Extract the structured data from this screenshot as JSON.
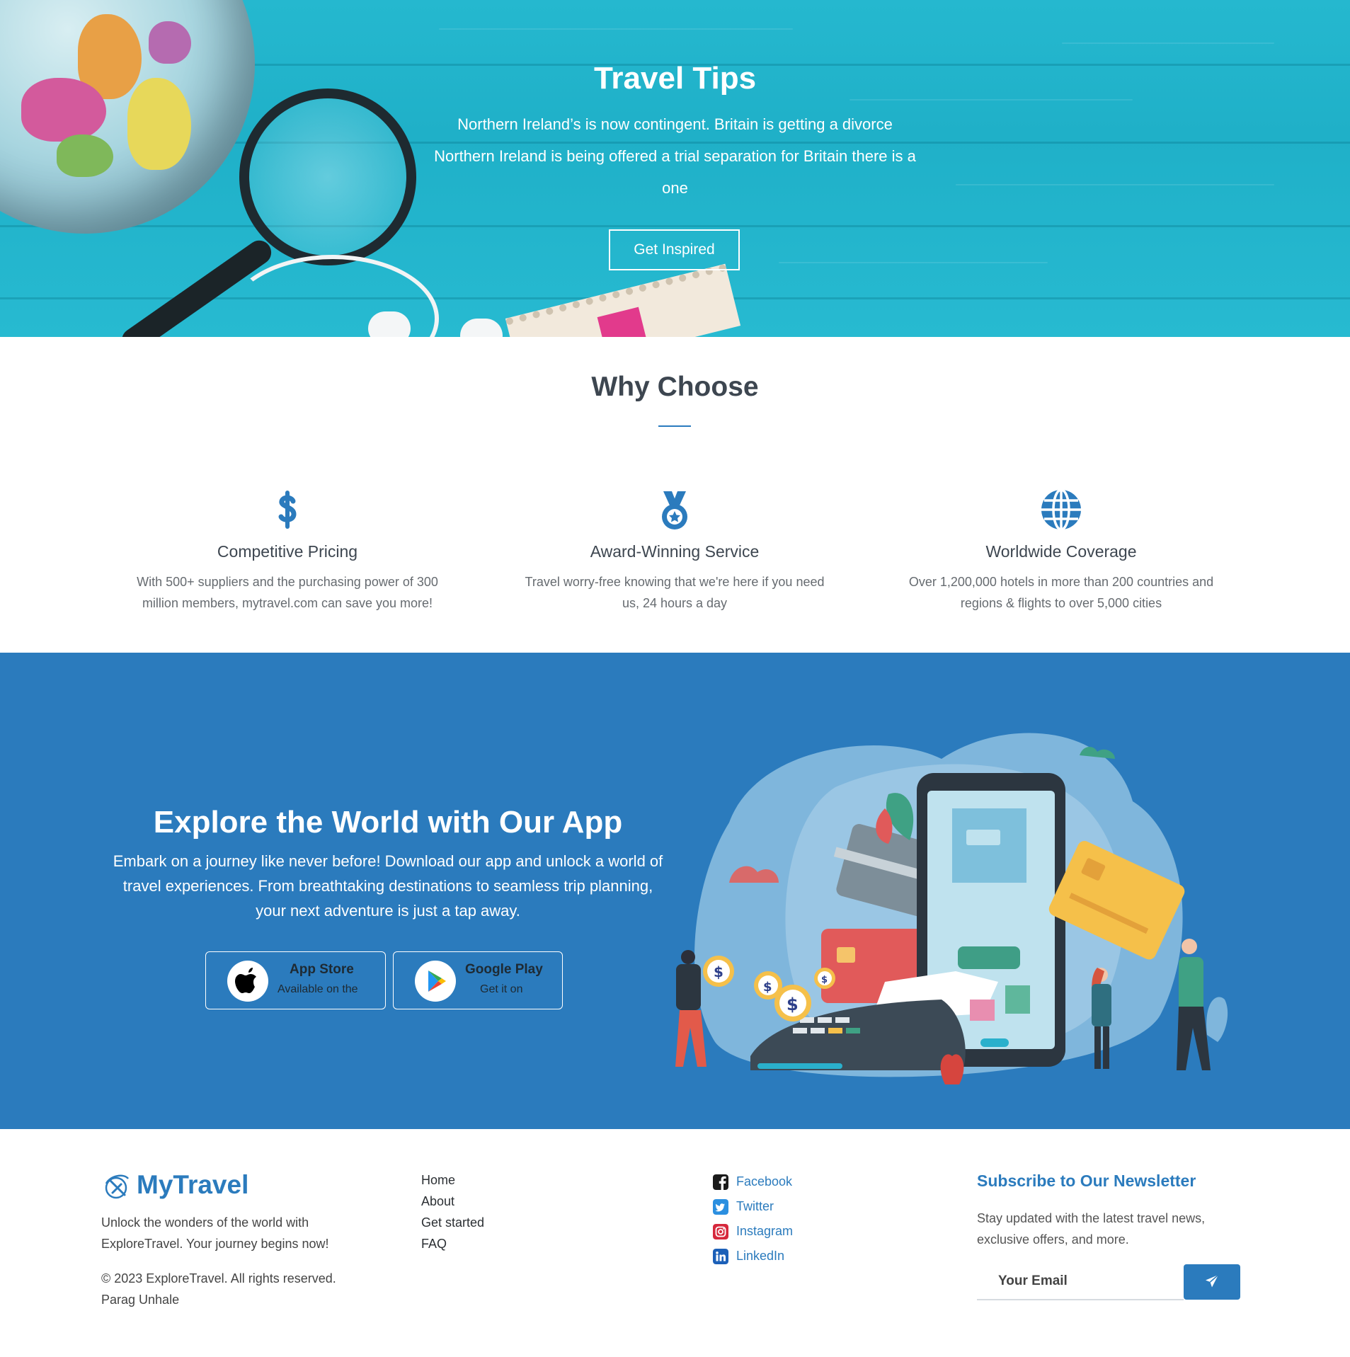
{
  "hero": {
    "title": "Travel Tips",
    "subtitle_lines": [
      "Northern Ireland’s is now contingent. Britain is getting a divorce",
      "Northern Ireland is being offered a trial separation for Britain there is a",
      "one"
    ],
    "button_label": "Get Inspired"
  },
  "why": {
    "title": "Why Choose",
    "features": [
      {
        "icon": "dollar-icon",
        "title": "Competitive Pricing",
        "lines": [
          "With 500+ suppliers and the purchasing power of 300",
          "million members, mytravel.com can save you more!"
        ]
      },
      {
        "icon": "medal-icon",
        "title": "Award-Winning Service",
        "lines": [
          "Travel worry-free knowing that we're here if you need",
          "us, 24 hours a day"
        ]
      },
      {
        "icon": "globe-icon",
        "title": "Worldwide Coverage",
        "lines": [
          "Over 1,200,000 hotels in more than 200 countries and",
          "regions & flights to over 5,000 cities"
        ]
      }
    ]
  },
  "app": {
    "title": "Explore the World with Our App",
    "text_lines": [
      "Embark on a journey like never before! Download our app and unlock a world of",
      "travel experiences. From breathtaking destinations to seamless trip planning,",
      "your next adventure is just a tap away."
    ],
    "app_store": {
      "label": "App Store",
      "sub": "Available on the",
      "icon": "apple-icon"
    },
    "google_play": {
      "label": "Google Play",
      "sub": "Get it on",
      "icon": "google-play-icon"
    }
  },
  "footer": {
    "brand": "MyTravel",
    "brand_icon": "plane-globe-icon",
    "tagline_lines": [
      "Unlock the wonders of the world with",
      "ExploreTravel. Your journey begins now!"
    ],
    "copyright": "© 2023 ExploreTravel. All rights reserved.",
    "author": "Parag Unhale",
    "links": [
      "Home",
      "About",
      "Get started",
      "FAQ"
    ],
    "socials": [
      {
        "label": "Facebook",
        "icon": "facebook-icon",
        "color": "#1a1a1a"
      },
      {
        "label": "Twitter",
        "icon": "twitter-icon",
        "color": "#2b8fe0"
      },
      {
        "label": "Instagram",
        "icon": "instagram-icon",
        "color": "#d6283c"
      },
      {
        "label": "LinkedIn",
        "icon": "linkedin-icon",
        "color": "#1c60b8"
      }
    ],
    "newsletter": {
      "title": "Subscribe to Our Newsletter",
      "text_lines": [
        "Stay updated with the latest travel news,",
        "exclusive offers, and more."
      ],
      "placeholder": "Your Email",
      "send_icon": "paper-plane-icon"
    }
  },
  "colors": {
    "primary": "#2b7bbd",
    "hero": "#22b4cc",
    "heading": "#3d4650"
  }
}
